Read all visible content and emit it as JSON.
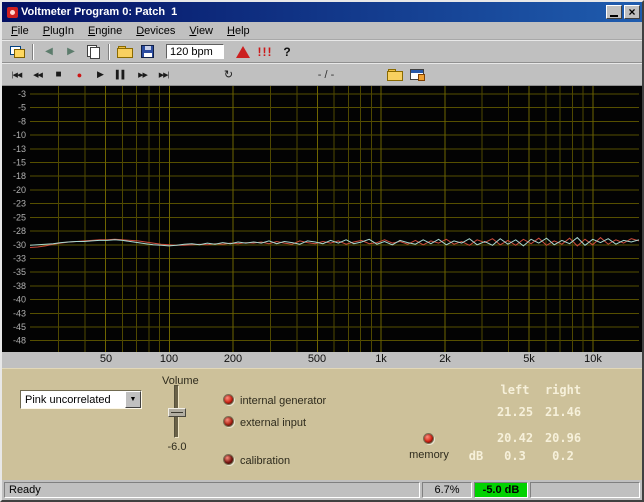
{
  "window": {
    "title": "Voltmeter Program 0: Patch  1",
    "close_glyph": "×"
  },
  "menu": {
    "items": [
      {
        "label": "File"
      },
      {
        "label": "PlugIn"
      },
      {
        "label": "Engine"
      },
      {
        "label": "Devices"
      },
      {
        "label": "View"
      },
      {
        "label": "Help"
      }
    ]
  },
  "toolbar": {
    "bpm": "120 bpm",
    "back_glyph": "◀",
    "forward_glyph": "▶",
    "alerts": "!!!",
    "help": "?"
  },
  "transport": {
    "glyphs": {
      "skip_start": "|◀◀",
      "rewind": "◀◀",
      "stop": "■",
      "record": "●",
      "play": "▶",
      "pause": "▌▌",
      "forward": "▶▶",
      "skip_end": "▶▶|",
      "loop": "↻"
    },
    "position": "- / -"
  },
  "chart_data": {
    "type": "line",
    "x_scale": "log",
    "x_range": [
      22,
      16500
    ],
    "y_top": -1.9,
    "y_bottom": -49.7,
    "y_tick_step": 2.5,
    "y_tick_start": -3,
    "y_tick_labels": [
      "-3",
      "-5",
      "-8",
      "-10",
      "-13",
      "-15",
      "-18",
      "-20",
      "-23",
      "-25",
      "-28",
      "-30",
      "-33",
      "-35",
      "-38",
      "-40",
      "-43",
      "-45",
      "-48"
    ],
    "x_ticks": [
      {
        "f": 50,
        "label": "50"
      },
      {
        "f": 100,
        "label": "100"
      },
      {
        "f": 200,
        "label": "200"
      },
      {
        "f": 500,
        "label": "500"
      },
      {
        "f": 1000,
        "label": "1k"
      },
      {
        "f": 2000,
        "label": "2k"
      },
      {
        "f": 5000,
        "label": "5k"
      },
      {
        "f": 10000,
        "label": "10k"
      }
    ],
    "x_grid": [
      30,
      40,
      50,
      60,
      70,
      80,
      90,
      100,
      200,
      300,
      400,
      500,
      600,
      700,
      800,
      900,
      1000,
      2000,
      3000,
      4000,
      5000,
      6000,
      7000,
      8000,
      9000,
      10000
    ],
    "grid_color_minor": "#4f4800",
    "grid_color_major": "#6e6400",
    "grid_color_h": "#564f00",
    "series": [
      {
        "name": "left",
        "color": "#cc4c3c",
        "values": [
          -31.0,
          -30.9,
          -30.7,
          -30.4,
          -30.2,
          -30.0,
          -29.9,
          -29.8,
          -29.7,
          -29.6,
          -29.6,
          -29.5,
          -29.6,
          -29.7,
          -29.8,
          -30.0,
          -30.2,
          -30.4,
          -30.5,
          -30.6,
          -30.6,
          -30.5,
          -30.4,
          -30.5,
          -30.3,
          -30.4,
          -30.2,
          -30.3,
          -30.1,
          -30.2,
          -30.0,
          -30.3,
          -29.9,
          -30.2,
          -30.4,
          -29.8,
          -30.1,
          -30.3,
          -29.9,
          -30.2,
          -29.8,
          -30.4,
          -30.0,
          -29.7,
          -30.3,
          -30.1,
          -29.6,
          -30.2,
          -29.9,
          -30.4,
          -29.7,
          -30.5,
          -29.8,
          -30.2,
          -29.5,
          -30.4,
          -29.9,
          -30.6,
          -29.6,
          -30.1,
          -29.4,
          -30.5,
          -29.7,
          -30.6,
          -29.5,
          -30.3,
          -29.3,
          -30.6,
          -29.8,
          -30.4,
          -29.3,
          -30.7,
          -29.5,
          -30.5,
          -29.2,
          -30.4,
          -29.6,
          -30.2,
          -29.4,
          -29.8
        ]
      },
      {
        "name": "right",
        "color": "#a8d8d0",
        "values": [
          -30.6,
          -30.5,
          -30.4,
          -30.3,
          -30.1,
          -30.0,
          -29.9,
          -29.9,
          -29.8,
          -29.7,
          -29.7,
          -29.6,
          -29.7,
          -29.9,
          -30.1,
          -30.3,
          -30.5,
          -30.6,
          -30.7,
          -30.6,
          -30.4,
          -30.3,
          -30.5,
          -30.2,
          -30.4,
          -30.1,
          -30.3,
          -30.0,
          -30.2,
          -30.0,
          -30.2,
          -29.8,
          -30.3,
          -29.9,
          -30.1,
          -30.4,
          -29.8,
          -30.0,
          -30.3,
          -29.7,
          -30.2,
          -29.6,
          -30.3,
          -30.0,
          -29.5,
          -30.4,
          -29.9,
          -30.5,
          -29.7,
          -30.1,
          -30.4,
          -29.6,
          -30.3,
          -29.5,
          -30.5,
          -29.8,
          -30.2,
          -29.4,
          -30.5,
          -29.9,
          -30.6,
          -29.4,
          -30.4,
          -29.6,
          -30.7,
          -29.5,
          -30.2,
          -29.3,
          -30.5,
          -29.7,
          -30.3,
          -29.2,
          -30.6,
          -29.5,
          -30.1,
          -29.4,
          -30.4,
          -29.7,
          -30.0,
          -29.6
        ]
      }
    ]
  },
  "controls": {
    "source_select": {
      "value": "Pink uncorrelated"
    },
    "volume": {
      "label": "Volume",
      "value": "-6.0"
    },
    "leds": [
      {
        "label": "internal generator",
        "color": "#d42818"
      },
      {
        "label": "external input",
        "color": "#b42818"
      },
      {
        "label": "calibration",
        "color": "#801a14"
      },
      {
        "label": "memory",
        "color": "#dc2818"
      }
    ],
    "readout": {
      "left_header": "left",
      "right_header": "right",
      "rows": [
        {
          "left": "21.25",
          "right": "21.46"
        },
        {
          "left": "20.42",
          "right": "20.96"
        }
      ],
      "db_label": "dB",
      "db_left": "0.3",
      "db_right": "0.2"
    }
  },
  "statusbar": {
    "ready": "Ready",
    "cpu": "6.7%",
    "level": "-5.0 dB",
    "level_bg": "#00d200"
  }
}
